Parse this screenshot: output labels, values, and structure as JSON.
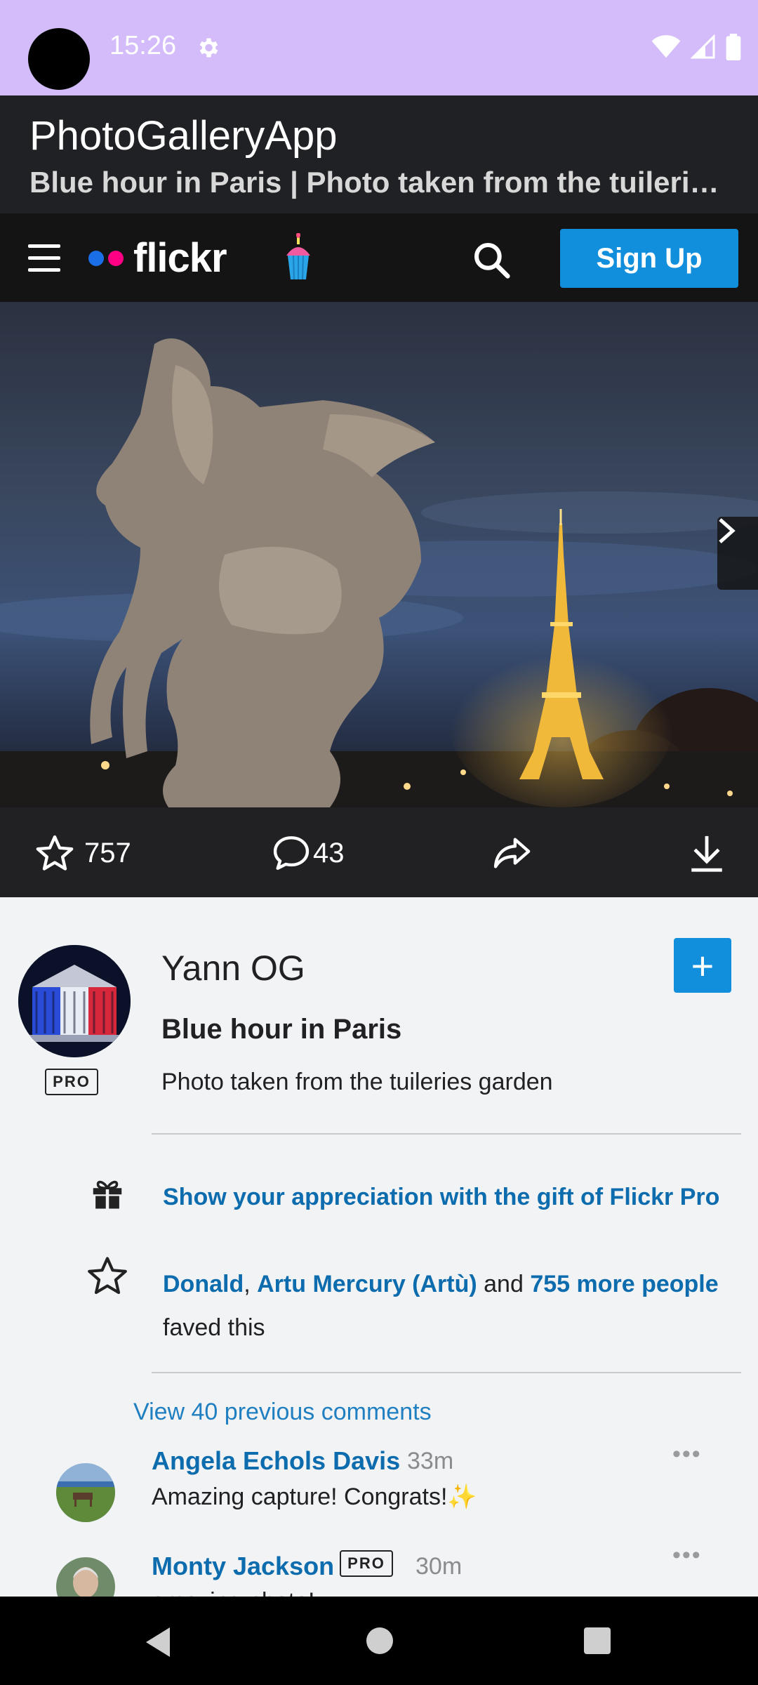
{
  "status_bar": {
    "time": "15:26",
    "icons": [
      "settings-gear-icon",
      "wifi-icon",
      "signal-icon",
      "battery-icon"
    ],
    "background": "#d3bcf9"
  },
  "app_bar": {
    "title": "PhotoGalleryApp",
    "subtitle": "Blue hour in Paris | Photo taken from the tuileries garden by Yann OG | Flickr"
  },
  "nav": {
    "logo_text": "flickr",
    "signup_label": "Sign Up",
    "icons": [
      "menu-icon",
      "cupcake-icon",
      "search-icon"
    ],
    "accent": "#128fdc"
  },
  "photo": {
    "description": "Statue of winged horse with rider at dusk, Eiffel Tower lit up in background"
  },
  "actions": {
    "faves": "757",
    "comments": "43",
    "icons": [
      "star-icon",
      "comment-icon",
      "share-icon",
      "download-icon"
    ]
  },
  "owner": {
    "name": "Yann OG",
    "pro_label": "PRO",
    "follow_label": "+"
  },
  "photo_info": {
    "title": "Blue hour in Paris",
    "description": "Photo taken from the tuileries garden"
  },
  "gift": {
    "label": "Show your appreciation with the gift of Flickr Pro"
  },
  "faves": {
    "user1": "Donald",
    "sep1": ", ",
    "user2": "Artu Mercury (Artù)",
    "and": " and ",
    "more": "755 more people",
    "suffix": " faved this"
  },
  "comments": {
    "view_previous": "View 40 previous comments",
    "items": [
      {
        "name": "Angela Echols Davis",
        "time": "33m",
        "text": "Amazing capture! Congrats!✨",
        "more": "•••"
      },
      {
        "name": "Monty Jackson",
        "pro": "PRO",
        "time": "30m",
        "text": "amazing photo!",
        "more": "•••"
      }
    ]
  }
}
